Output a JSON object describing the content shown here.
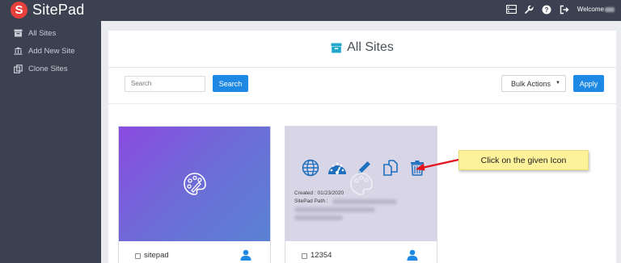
{
  "app": {
    "name": "SitePad"
  },
  "topbar": {
    "welcome_label": "Welcome"
  },
  "sidebar": {
    "items": [
      {
        "label": "All Sites",
        "icon": "archive-icon"
      },
      {
        "label": "Add New Site",
        "icon": "bank-icon"
      },
      {
        "label": "Clone Sites",
        "icon": "clone-icon"
      }
    ]
  },
  "main": {
    "title": "All Sites",
    "search": {
      "placeholder": "Search",
      "button_label": "Search"
    },
    "bulk": {
      "selected": "Bulk Actions",
      "apply_label": "Apply"
    }
  },
  "sites": [
    {
      "name": "sitepad"
    },
    {
      "name": "12354",
      "created_label": "Created : 01/23/2020",
      "path_label": "SitePad Path :"
    }
  ],
  "callout": {
    "text": "Click on the given Icon"
  },
  "colors": {
    "accent": "#1e88e5",
    "topbar": "#3b4150",
    "brand": "#e8403a",
    "callout_bg": "#fdf29a",
    "arrow": "#e5131d"
  }
}
